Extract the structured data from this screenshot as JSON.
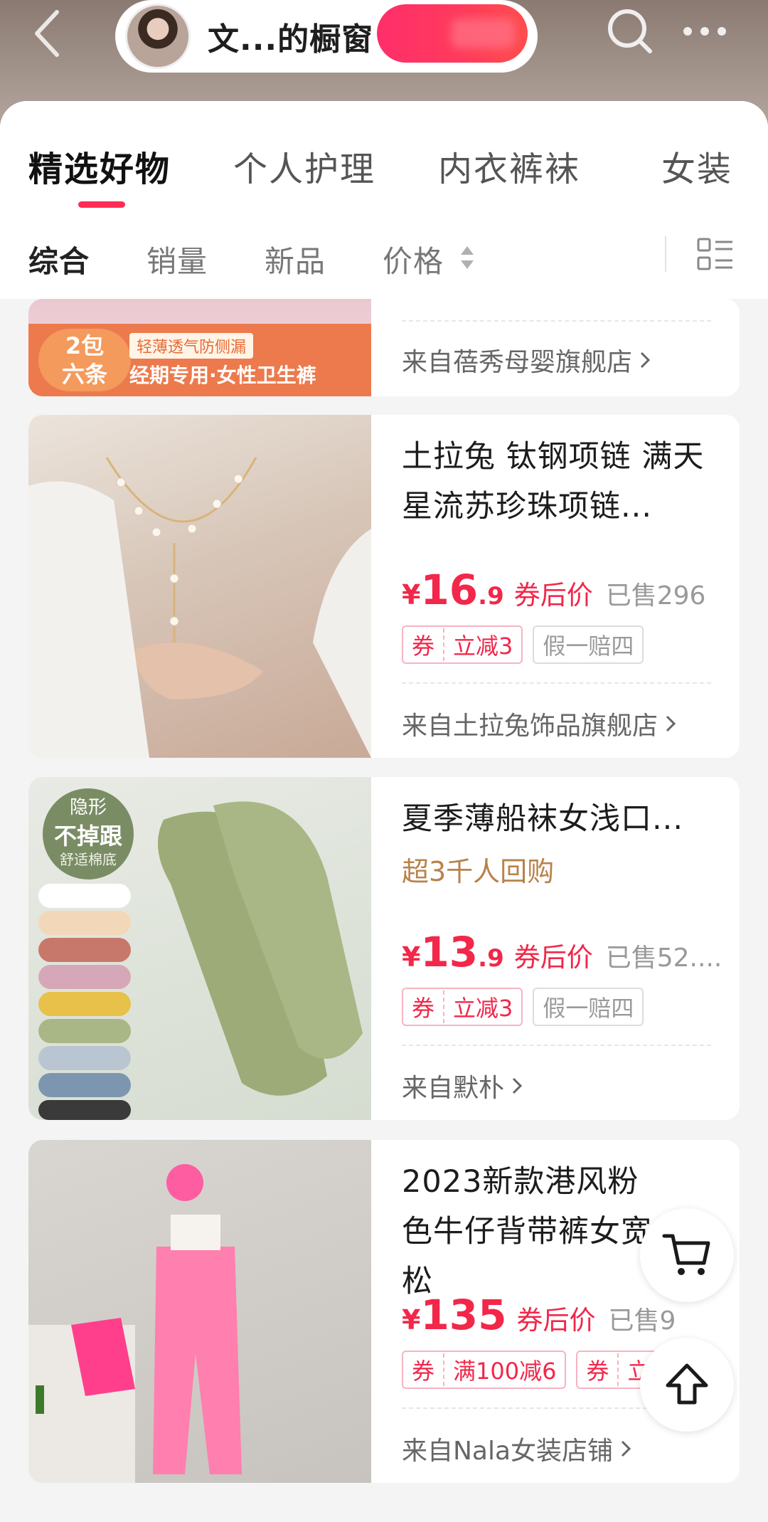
{
  "header": {
    "back_icon": "chevron-left-icon",
    "store_name": "文...的橱窗",
    "search_icon": "search-icon",
    "more_icon": "more-dots-icon"
  },
  "categories": [
    {
      "label": "精选好物",
      "active": true
    },
    {
      "label": "个人护理",
      "active": false
    },
    {
      "label": "内衣裤袜",
      "active": false
    },
    {
      "label": "女装",
      "active": false
    }
  ],
  "sort": {
    "items": [
      "综合",
      "销量",
      "新品",
      "价格"
    ],
    "active_index": 0,
    "layout_icon": "list-layout-icon"
  },
  "products": [
    {
      "partial": true,
      "image_badge_1": "2包",
      "image_badge_2": "六条",
      "image_text_1": "轻薄透气防侧漏",
      "image_text_2": "经期专用·女性卫生裤",
      "shop": "来自蓓秀母婴旗舰店"
    },
    {
      "title": "土拉兔 钛钢项链 满天星流苏珍珠项链...",
      "price_int": "16",
      "price_dec": ".9",
      "currency": "¥",
      "after_coupon": "券后价",
      "sold": "已售296",
      "tags": [
        {
          "type": "coupon",
          "k": "券",
          "v": "立减3"
        },
        {
          "type": "plain",
          "v": "假一赔四"
        }
      ],
      "shop": "来自土拉兔饰品旗舰店"
    },
    {
      "title": "夏季薄船袜女浅口...",
      "repurchase": "超3千人回购",
      "image_badge_1": "隐形",
      "image_badge_2": "不掉跟",
      "image_badge_3": "舒适棉底",
      "price_int": "13",
      "price_dec": ".9",
      "currency": "¥",
      "after_coupon": "券后价",
      "sold": "已售52....",
      "tags": [
        {
          "type": "coupon",
          "k": "券",
          "v": "立减3"
        },
        {
          "type": "plain",
          "v": "假一赔四"
        }
      ],
      "shop": "来自默朴"
    },
    {
      "title": "2023新款港风粉色牛仔背带裤女宽松",
      "price_int": "135",
      "price_dec": "",
      "currency": "¥",
      "after_coupon": "券后价",
      "sold": "已售9",
      "tags": [
        {
          "type": "coupon",
          "k": "券",
          "v": "满100减6"
        },
        {
          "type": "coupon",
          "k": "券",
          "v": "立减3"
        }
      ],
      "shop": "来自Nala女装店铺"
    }
  ],
  "fabs": {
    "cart_icon": "cart-icon",
    "top_icon": "back-to-top-icon"
  },
  "colors": {
    "accent": "#f2274a",
    "follow_gradient": "#ff2e6a",
    "header_bg": "#8a7a72"
  }
}
